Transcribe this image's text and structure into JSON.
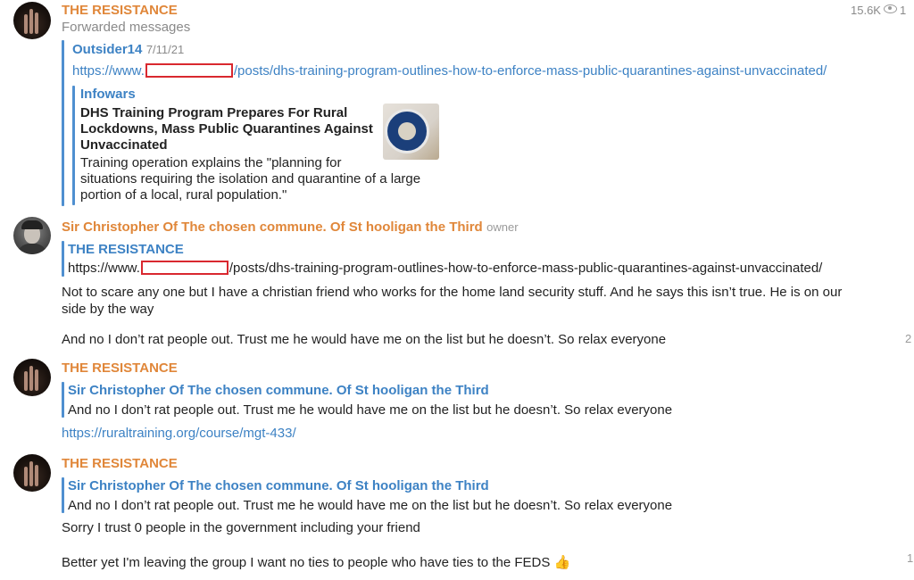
{
  "messages": [
    {
      "sender": "THE RESISTANCE",
      "forwarded_label": "Forwarded messages",
      "views": "15.6K",
      "count": "1",
      "forward_from": "Outsider14",
      "forward_date": "7/11/21",
      "url_prefix": "https://www.",
      "url_suffix": "/posts/dhs-training-program-outlines-how-to-enforce-mass-public-quarantines-against-unvaccinated/",
      "preview": {
        "site": "Infowars",
        "title_lines": [
          "DHS Training Program Prepares For Rural",
          "Lockdowns, Mass Public Quarantines Against",
          "Unvaccinated"
        ],
        "desc_lines": [
          "Training operation explains the \"planning for",
          "situations requiring the isolation and quarantine of a large",
          "portion of a local, rural population.\""
        ]
      }
    },
    {
      "sender": "Sir Christopher Of The chosen commune. Of St hooligan the Third",
      "badge": "owner",
      "reply_to": "THE RESISTANCE",
      "reply_url_prefix": "https://www.",
      "reply_url_suffix": "/posts/dhs-training-program-outlines-how-to-enforce-mass-public-quarantines-against-unvaccinated/",
      "lines": [
        "Not to scare any one but I have a christian friend who works for the home land security stuff. And he says this isn’t true. He is on our",
        "side by the way"
      ],
      "line2": "And no I don’t rat people out. Trust me he would have me on the list but he doesn’t. So relax everyone",
      "count": "2"
    },
    {
      "sender": "THE RESISTANCE",
      "reply_to": "Sir Christopher Of The chosen commune. Of St hooligan the Third",
      "reply_text": "And no I don’t rat people out. Trust me he would have me on the list but he doesn’t. So relax everyone",
      "link": "https://ruraltraining.org/course/mgt-433/"
    },
    {
      "sender": "THE RESISTANCE",
      "reply_to": "Sir Christopher Of The chosen commune. Of St hooligan the Third",
      "reply_text": "And no I don’t rat people out. Trust me he would have me on the list but he doesn’t. So relax everyone",
      "text1": "Sorry I trust 0 people in the government including your friend",
      "text2": "Better yet I'm leaving the group I want no ties to people who have ties to the FEDS",
      "emoji": "👍",
      "count": "1"
    }
  ],
  "colors": {
    "orange": "#e0873a",
    "blue": "#3d82c4",
    "redaction": "#d9282f"
  },
  "icons": [
    "eye-icon",
    "thumbs-up-icon"
  ]
}
